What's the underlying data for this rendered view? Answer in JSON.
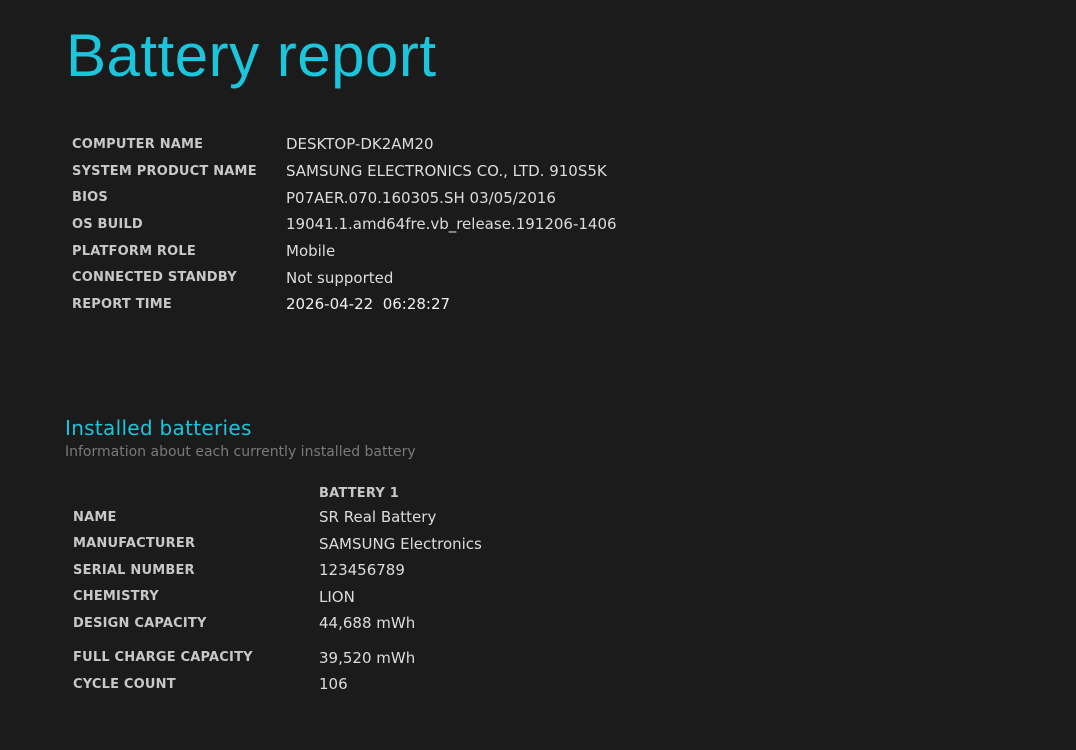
{
  "report": {
    "title": "Battery report"
  },
  "system_info": [
    {
      "label": "COMPUTER NAME",
      "value": "DESKTOP-DK2AM20"
    },
    {
      "label": "SYSTEM PRODUCT NAME",
      "value": "SAMSUNG ELECTRONICS CO., LTD. 910S5K"
    },
    {
      "label": "BIOS",
      "value": "P07AER.070.160305.SH 03/05/2016"
    },
    {
      "label": "OS BUILD",
      "value": "19041.1.amd64fre.vb_release.191206-1406"
    },
    {
      "label": "PLATFORM ROLE",
      "value": "Mobile"
    },
    {
      "label": "CONNECTED STANDBY",
      "value": "Not supported"
    },
    {
      "label": "REPORT TIME",
      "value": "2026-04-22  06:28:27"
    }
  ],
  "installed_batteries": {
    "title": "Installed batteries",
    "subtitle": "Information about each currently installed battery",
    "column_header": "BATTERY 1",
    "rows": [
      {
        "label": "NAME",
        "value": "SR Real Battery"
      },
      {
        "label": "MANUFACTURER",
        "value": "SAMSUNG Electronics"
      },
      {
        "label": "SERIAL NUMBER",
        "value": "123456789"
      },
      {
        "label": "CHEMISTRY",
        "value": "LION"
      },
      {
        "label": "DESIGN CAPACITY",
        "value": "44,688 mWh"
      },
      {
        "label": "FULL CHARGE CAPACITY",
        "value": "39,520 mWh"
      },
      {
        "label": "CYCLE COUNT",
        "value": "106"
      }
    ]
  },
  "colors": {
    "background": "#1b1b1b",
    "accent": "#1bc6dc",
    "label": "#c8c8c8",
    "value": "#dcdcdc",
    "muted": "#7a7a7a"
  }
}
